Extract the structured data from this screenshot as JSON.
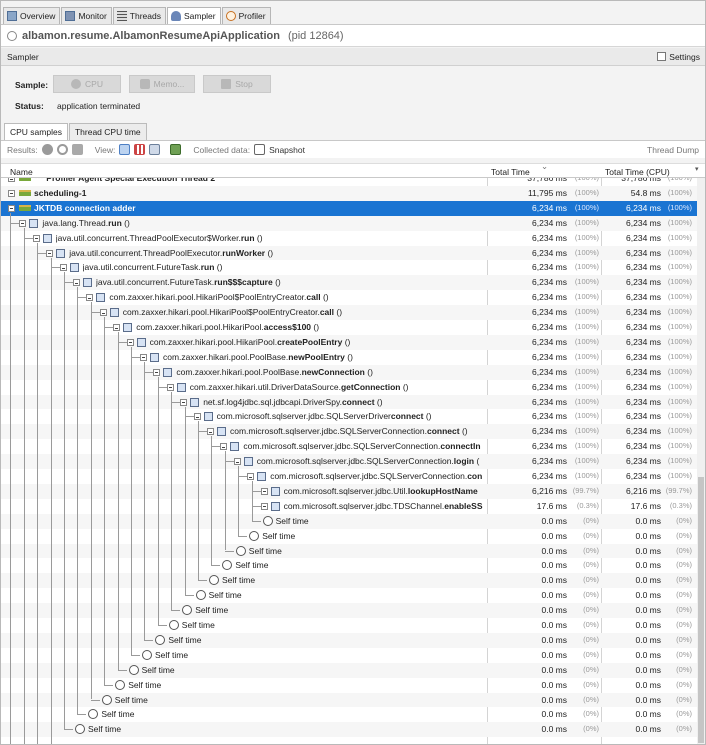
{
  "tabs": [
    {
      "label": "Overview",
      "icon": "overview-icon"
    },
    {
      "label": "Monitor",
      "icon": "monitor-icon"
    },
    {
      "label": "Threads",
      "icon": "threads-icon"
    },
    {
      "label": "Sampler",
      "icon": "sampler-icon"
    },
    {
      "label": "Profiler",
      "icon": "profiler-icon"
    }
  ],
  "header": {
    "app": "albamon.resume.AlbamonResumeApiApplication",
    "pid": "(pid 12864)"
  },
  "sampler_bar": {
    "title": "Sampler",
    "settings": "Settings"
  },
  "controls": {
    "sample_label": "Sample:",
    "cpu": "CPU",
    "memory": "Memo...",
    "stop": "Stop",
    "status_label": "Status:",
    "status": "application terminated"
  },
  "subtabs": [
    "CPU samples",
    "Thread CPU time"
  ],
  "toolbar": {
    "results": "Results:",
    "view": "View:",
    "collected": "Collected data:",
    "snapshot": "Snapshot",
    "thread_dump": "Thread Dump"
  },
  "columns": {
    "name": "Name",
    "total": "Total Time",
    "cpu": "Total Time (CPU)"
  },
  "rows": [
    {
      "d": 0,
      "name": "*** Profiler Agent Special Execution Thread 2",
      "bold": true,
      "t": "37,786 ms",
      "tp": "(100%)",
      "c": "37,786 ms",
      "cp": "(100%)",
      "k": "thread"
    },
    {
      "d": 0,
      "name": "scheduling-1",
      "bold": true,
      "t": "11,795 ms",
      "tp": "(100%)",
      "c": "54.8 ms",
      "cp": "(100%)",
      "k": "thread"
    },
    {
      "d": 0,
      "name": "JKTDB connection adder",
      "bold": true,
      "t": "6,234 ms",
      "tp": "(100%)",
      "c": "6,234 ms",
      "cp": "(100%)",
      "k": "thread",
      "sel": true
    },
    {
      "d": 1,
      "name": "java.lang.Thread.",
      "b": "run",
      "s": " ()",
      "t": "6,234 ms",
      "tp": "(100%)",
      "c": "6,234 ms",
      "cp": "(100%)"
    },
    {
      "d": 2,
      "name": "java.util.concurrent.ThreadPoolExecutor$Worker.",
      "b": "run",
      "s": " ()",
      "t": "6,234 ms",
      "tp": "(100%)",
      "c": "6,234 ms",
      "cp": "(100%)"
    },
    {
      "d": 3,
      "name": "java.util.concurrent.ThreadPoolExecutor.",
      "b": "runWorker",
      "s": " ()",
      "t": "6,234 ms",
      "tp": "(100%)",
      "c": "6,234 ms",
      "cp": "(100%)"
    },
    {
      "d": 4,
      "name": "java.util.concurrent.FutureTask.",
      "b": "run",
      "s": " ()",
      "t": "6,234 ms",
      "tp": "(100%)",
      "c": "6,234 ms",
      "cp": "(100%)"
    },
    {
      "d": 5,
      "name": "java.util.concurrent.FutureTask.",
      "b": "run$$$capture",
      "s": " ()",
      "t": "6,234 ms",
      "tp": "(100%)",
      "c": "6,234 ms",
      "cp": "(100%)"
    },
    {
      "d": 6,
      "name": "com.zaxxer.hikari.pool.HikariPool$PoolEntryCreator.",
      "b": "call",
      "s": " ()",
      "t": "6,234 ms",
      "tp": "(100%)",
      "c": "6,234 ms",
      "cp": "(100%)"
    },
    {
      "d": 7,
      "name": "com.zaxxer.hikari.pool.HikariPool$PoolEntryCreator.",
      "b": "call",
      "s": " ()",
      "t": "6,234 ms",
      "tp": "(100%)",
      "c": "6,234 ms",
      "cp": "(100%)"
    },
    {
      "d": 8,
      "name": "com.zaxxer.hikari.pool.HikariPool.",
      "b": "access$100",
      "s": " ()",
      "t": "6,234 ms",
      "tp": "(100%)",
      "c": "6,234 ms",
      "cp": "(100%)"
    },
    {
      "d": 9,
      "name": "com.zaxxer.hikari.pool.HikariPool.",
      "b": "createPoolEntry",
      "s": " ()",
      "t": "6,234 ms",
      "tp": "(100%)",
      "c": "6,234 ms",
      "cp": "(100%)"
    },
    {
      "d": 10,
      "name": "com.zaxxer.hikari.pool.PoolBase.",
      "b": "newPoolEntry",
      "s": " ()",
      "t": "6,234 ms",
      "tp": "(100%)",
      "c": "6,234 ms",
      "cp": "(100%)"
    },
    {
      "d": 11,
      "name": "com.zaxxer.hikari.pool.PoolBase.",
      "b": "newConnection",
      "s": " ()",
      "t": "6,234 ms",
      "tp": "(100%)",
      "c": "6,234 ms",
      "cp": "(100%)"
    },
    {
      "d": 12,
      "name": "com.zaxxer.hikari.util.DriverDataSource.",
      "b": "getConnection",
      "s": " ()",
      "t": "6,234 ms",
      "tp": "(100%)",
      "c": "6,234 ms",
      "cp": "(100%)"
    },
    {
      "d": 13,
      "name": "net.sf.log4jdbc.sql.jdbcapi.DriverSpy.",
      "b": "connect",
      "s": " ()",
      "t": "6,234 ms",
      "tp": "(100%)",
      "c": "6,234 ms",
      "cp": "(100%)"
    },
    {
      "d": 14,
      "name": "com.microsoft.sqlserver.jdbc.SQLServerDriver",
      "b": "connect",
      "s": " ()",
      "t": "6,234 ms",
      "tp": "(100%)",
      "c": "6,234 ms",
      "cp": "(100%)"
    },
    {
      "d": 15,
      "name": "com.microsoft.sqlserver.jdbc.SQLServerConnection.",
      "b": "connect",
      "s": " ()",
      "t": "6,234 ms",
      "tp": "(100%)",
      "c": "6,234 ms",
      "cp": "(100%)"
    },
    {
      "d": 16,
      "name": "com.microsoft.sqlserver.jdbc.SQLServerConnection.",
      "b": "connectIn",
      "s": "",
      "t": "6,234 ms",
      "tp": "(100%)",
      "c": "6,234 ms",
      "cp": "(100%)"
    },
    {
      "d": 17,
      "name": "com.microsoft.sqlserver.jdbc.SQLServerConnection.",
      "b": "login",
      "s": " (",
      "t": "6,234 ms",
      "tp": "(100%)",
      "c": "6,234 ms",
      "cp": "(100%)"
    },
    {
      "d": 18,
      "name": "com.microsoft.sqlserver.jdbc.SQLServerConnection.",
      "b": "con",
      "s": "",
      "t": "6,234 ms",
      "tp": "(100%)",
      "c": "6,234 ms",
      "cp": "(100%)"
    },
    {
      "d": 19,
      "name": "com.microsoft.sqlserver.jdbc.Util.",
      "b": "lookupHostName",
      "s": "",
      "t": "6,216 ms",
      "tp": "(99.7%)",
      "c": "6,216 ms",
      "cp": "(99.7%)",
      "plus": true
    },
    {
      "d": 19,
      "name": "com.microsoft.sqlserver.jdbc.TDSChannel.",
      "b": "enableSS",
      "s": "",
      "t": "17.6 ms",
      "tp": "(0.3%)",
      "c": "17.6 ms",
      "cp": "(0.3%)",
      "plus": true
    },
    {
      "d": 19,
      "name": "Self time",
      "k": "self",
      "t": "0.0 ms",
      "tp": "(0%)",
      "c": "0.0 ms",
      "cp": "(0%)"
    },
    {
      "d": 18,
      "name": "Self time",
      "k": "self",
      "t": "0.0 ms",
      "tp": "(0%)",
      "c": "0.0 ms",
      "cp": "(0%)"
    },
    {
      "d": 17,
      "name": "Self time",
      "k": "self",
      "t": "0.0 ms",
      "tp": "(0%)",
      "c": "0.0 ms",
      "cp": "(0%)"
    },
    {
      "d": 16,
      "name": "Self time",
      "k": "self",
      "t": "0.0 ms",
      "tp": "(0%)",
      "c": "0.0 ms",
      "cp": "(0%)"
    },
    {
      "d": 15,
      "name": "Self time",
      "k": "self",
      "t": "0.0 ms",
      "tp": "(0%)",
      "c": "0.0 ms",
      "cp": "(0%)"
    },
    {
      "d": 14,
      "name": "Self time",
      "k": "self",
      "t": "0.0 ms",
      "tp": "(0%)",
      "c": "0.0 ms",
      "cp": "(0%)"
    },
    {
      "d": 13,
      "name": "Self time",
      "k": "self",
      "t": "0.0 ms",
      "tp": "(0%)",
      "c": "0.0 ms",
      "cp": "(0%)"
    },
    {
      "d": 12,
      "name": "Self time",
      "k": "self",
      "t": "0.0 ms",
      "tp": "(0%)",
      "c": "0.0 ms",
      "cp": "(0%)"
    },
    {
      "d": 11,
      "name": "Self time",
      "k": "self",
      "t": "0.0 ms",
      "tp": "(0%)",
      "c": "0.0 ms",
      "cp": "(0%)"
    },
    {
      "d": 10,
      "name": "Self time",
      "k": "self",
      "t": "0.0 ms",
      "tp": "(0%)",
      "c": "0.0 ms",
      "cp": "(0%)"
    },
    {
      "d": 9,
      "name": "Self time",
      "k": "self",
      "t": "0.0 ms",
      "tp": "(0%)",
      "c": "0.0 ms",
      "cp": "(0%)"
    },
    {
      "d": 8,
      "name": "Self time",
      "k": "self",
      "t": "0.0 ms",
      "tp": "(0%)",
      "c": "0.0 ms",
      "cp": "(0%)"
    },
    {
      "d": 7,
      "name": "Self time",
      "k": "self",
      "t": "0.0 ms",
      "tp": "(0%)",
      "c": "0.0 ms",
      "cp": "(0%)"
    },
    {
      "d": 6,
      "name": "Self time",
      "k": "self",
      "t": "0.0 ms",
      "tp": "(0%)",
      "c": "0.0 ms",
      "cp": "(0%)"
    },
    {
      "d": 5,
      "name": "Self time",
      "k": "self",
      "t": "0.0 ms",
      "tp": "(0%)",
      "c": "0.0 ms",
      "cp": "(0%)"
    }
  ]
}
